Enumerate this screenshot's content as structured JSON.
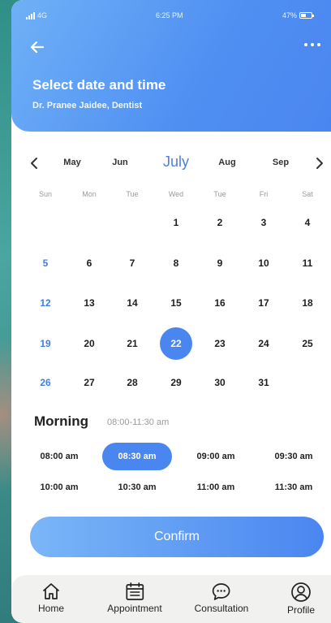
{
  "status": {
    "network": "4G",
    "time": "6:25 PM",
    "battery": "47%",
    "battery_level": 0.47
  },
  "header": {
    "title": "Select date and time",
    "subtitle": "Dr. Pranee Jaidee, Dentist",
    "back_icon": "arrow-left-icon",
    "more_icon": "more-horizontal-icon"
  },
  "calendar": {
    "months": [
      "May",
      "Jun",
      "July",
      "Aug",
      "Sep"
    ],
    "active_month": "July",
    "weekdays": [
      "Sun",
      "Mon",
      "Tue",
      "Wed",
      "Tue",
      "Fri",
      "Sat"
    ],
    "weeks": [
      [
        "",
        "",
        "",
        "1",
        "2",
        "3",
        "4"
      ],
      [
        "5",
        "6",
        "7",
        "8",
        "9",
        "10",
        "11"
      ],
      [
        "12",
        "13",
        "14",
        "15",
        "16",
        "17",
        "18"
      ],
      [
        "19",
        "20",
        "21",
        "22",
        "23",
        "24",
        "25"
      ],
      [
        "26",
        "27",
        "28",
        "29",
        "30",
        "31",
        ""
      ]
    ],
    "selected_day": "22",
    "prev_icon": "chevron-left-icon",
    "next_icon": "chevron-right-icon"
  },
  "morning": {
    "label": "Morning",
    "range": "08:00-11:30 am",
    "slots": [
      "08:00 am",
      "08:30 am",
      "09:00 am",
      "09:30 am",
      "10:00 am",
      "10:30 am",
      "11:00 am",
      "11:30 am"
    ],
    "selected_slot": "08:30 am"
  },
  "confirm_label": "Confirm",
  "bottom_nav": [
    {
      "label": "Home",
      "icon": "home-icon"
    },
    {
      "label": "Appointment",
      "icon": "calendar-icon"
    },
    {
      "label": "Consultation",
      "icon": "chat-bubble-icon"
    },
    {
      "label": "Profile",
      "icon": "user-icon"
    }
  ],
  "colors": {
    "accent": "#4a86ef",
    "sunday": "#3f7fe8",
    "header_start": "#6fb1f7",
    "header_end": "#4a86f0"
  }
}
